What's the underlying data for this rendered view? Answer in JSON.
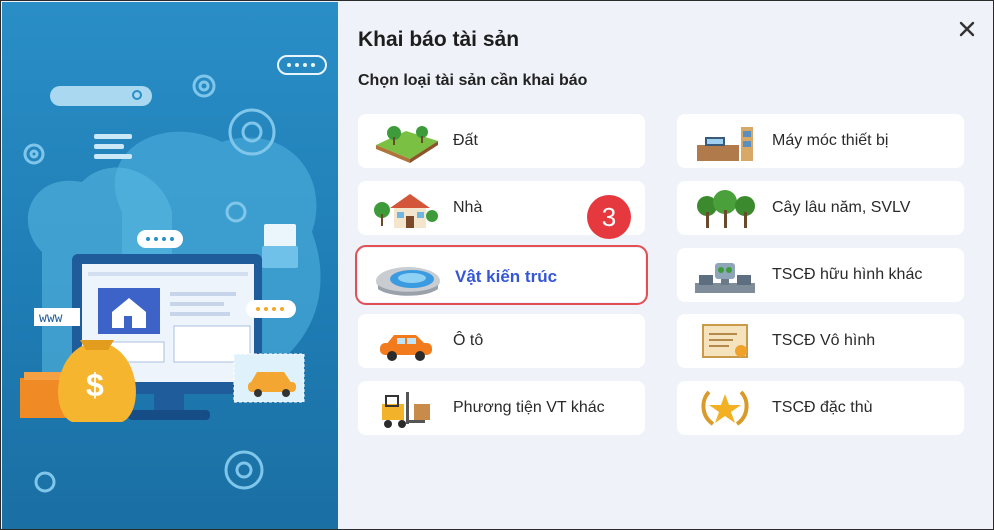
{
  "dialog": {
    "title": "Khai báo tài sản",
    "subtitle": "Chọn loại tài sản cần khai báo",
    "close_icon": "close-icon"
  },
  "illustration": {
    "url_text": "www",
    "currency_symbol": "$"
  },
  "asset_types": [
    {
      "label": "Đất",
      "icon": "land-icon"
    },
    {
      "label": "Máy móc thiết bị",
      "icon": "machinery-icon"
    },
    {
      "label": "Nhà",
      "icon": "house-icon"
    },
    {
      "label": "Cây lâu năm, SVLV",
      "icon": "trees-icon"
    },
    {
      "label": "Vật kiến trúc",
      "icon": "pool-icon",
      "selected": true
    },
    {
      "label": "TSCĐ hữu hình khác",
      "icon": "robot-icon"
    },
    {
      "label": "Ô tô",
      "icon": "car-icon"
    },
    {
      "label": "TSCĐ Vô hình",
      "icon": "certificate-icon"
    },
    {
      "label": "Phương tiện VT khác",
      "icon": "forklift-icon"
    },
    {
      "label": "TSCĐ đặc thù",
      "icon": "laurel-star-icon"
    }
  ],
  "step_marker": "3",
  "colors": {
    "selected_text": "#3557d5",
    "selected_outline": "#e24f55",
    "badge": "#e6393f",
    "panel_bg": "#eff2f8"
  }
}
